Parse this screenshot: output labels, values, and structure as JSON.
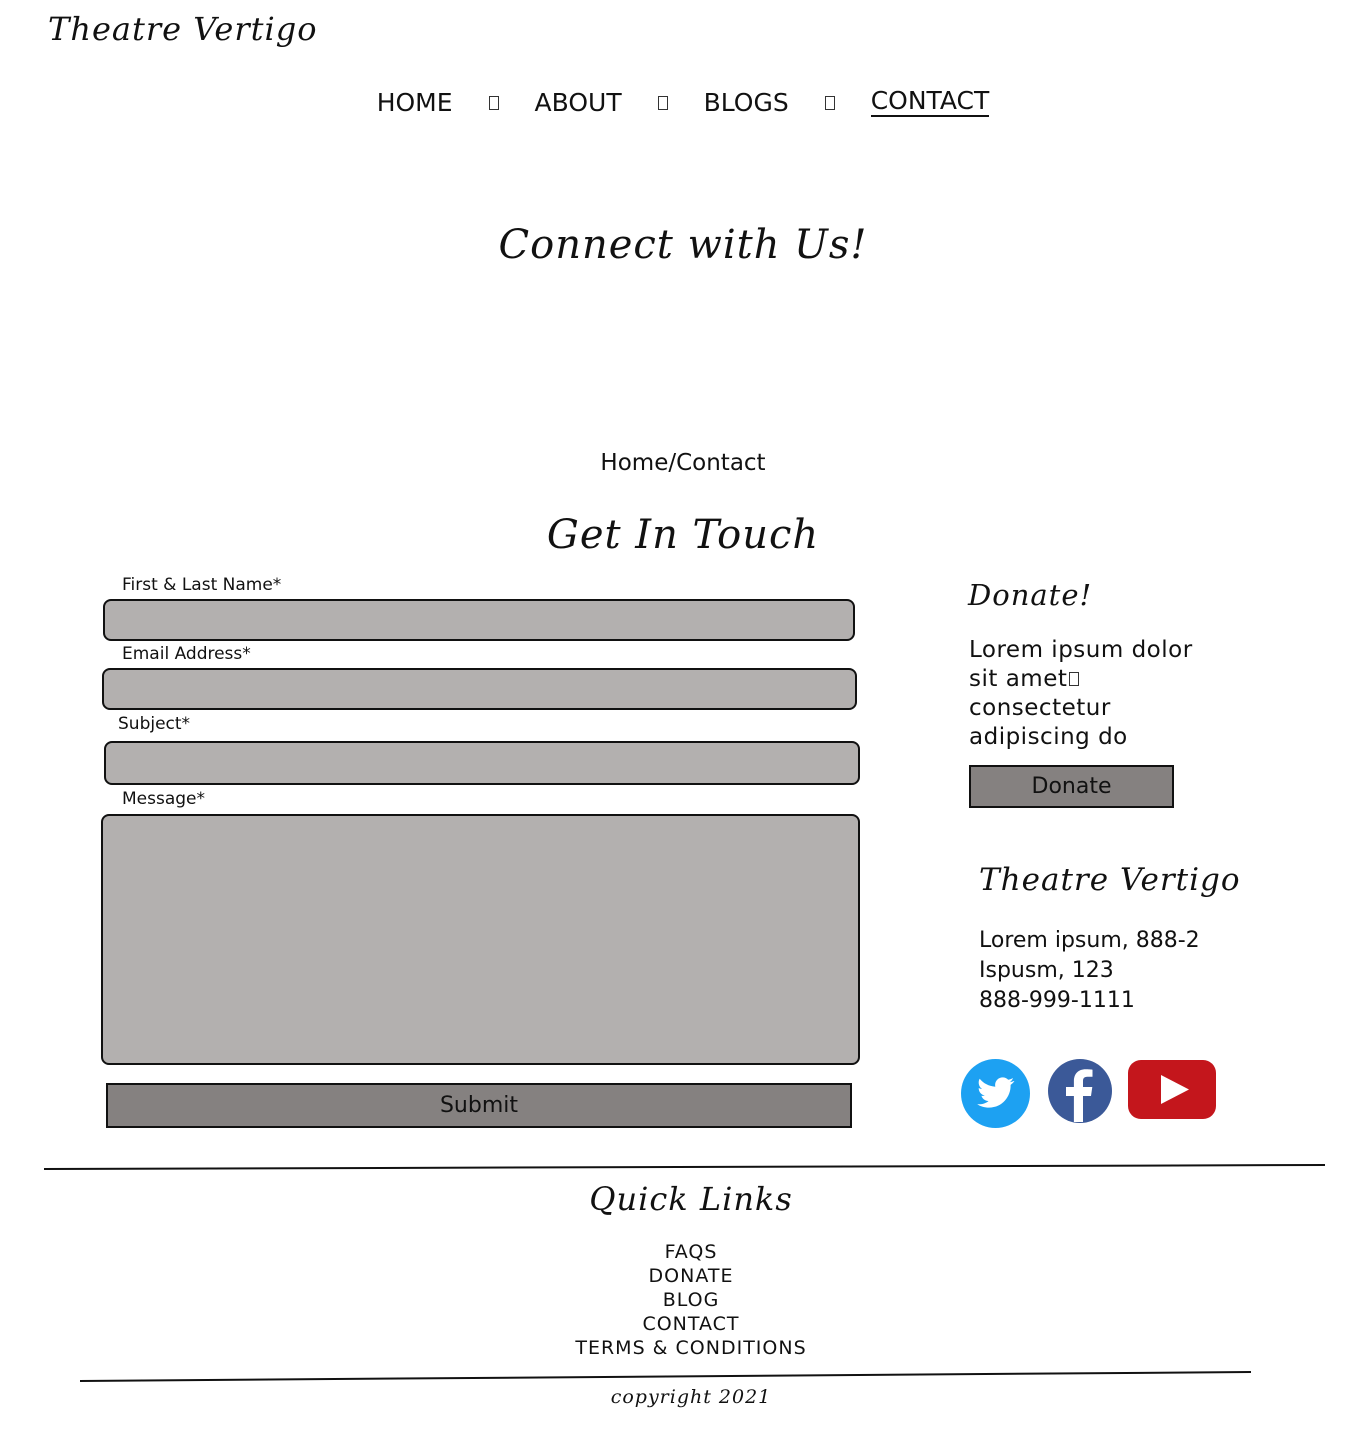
{
  "header": {
    "logo": "Theatre Vertigo",
    "nav": [
      "HOME",
      "ABOUT",
      "BLOGS",
      "CONTACT"
    ],
    "active_nav": "CONTACT"
  },
  "hero": {
    "title": "Connect with Us!"
  },
  "breadcrumb": {
    "home": "Home",
    "separator": "/",
    "current": "Contact"
  },
  "form": {
    "title": "Get In Touch",
    "fields": [
      {
        "label": "First & Last Name*",
        "value": ""
      },
      {
        "label": "Email Address*",
        "value": ""
      },
      {
        "label": "Subject*",
        "value": ""
      },
      {
        "label": "Message*",
        "value": ""
      }
    ],
    "submit_label": "Submit",
    "field_color": "#b3b0af",
    "button_color": "#858180"
  },
  "donate": {
    "title": "Donate!",
    "text_lines": [
      "Lorem ipsum dolor",
      "sit amet",
      "consectetur",
      "adipiscing do"
    ],
    "button_label": "Donate"
  },
  "organization": {
    "name": "Theatre Vertigo",
    "address_lines": [
      "Lorem ipsum, 888-2",
      "Ispusm, 123",
      "888-999-1111"
    ]
  },
  "social": [
    {
      "icon": "twitter-icon",
      "color": "#1da1f2"
    },
    {
      "icon": "facebook-icon",
      "color": "#3b5998"
    },
    {
      "icon": "youtube-icon",
      "color": "#c4161c"
    }
  ],
  "footer": {
    "quick_links_title": "Quick Links",
    "links": [
      "FAQS",
      "DONATE",
      "BLOG",
      "CONTACT",
      "TERMS & CONDITIONS"
    ],
    "copyright": "copyright 2021"
  }
}
